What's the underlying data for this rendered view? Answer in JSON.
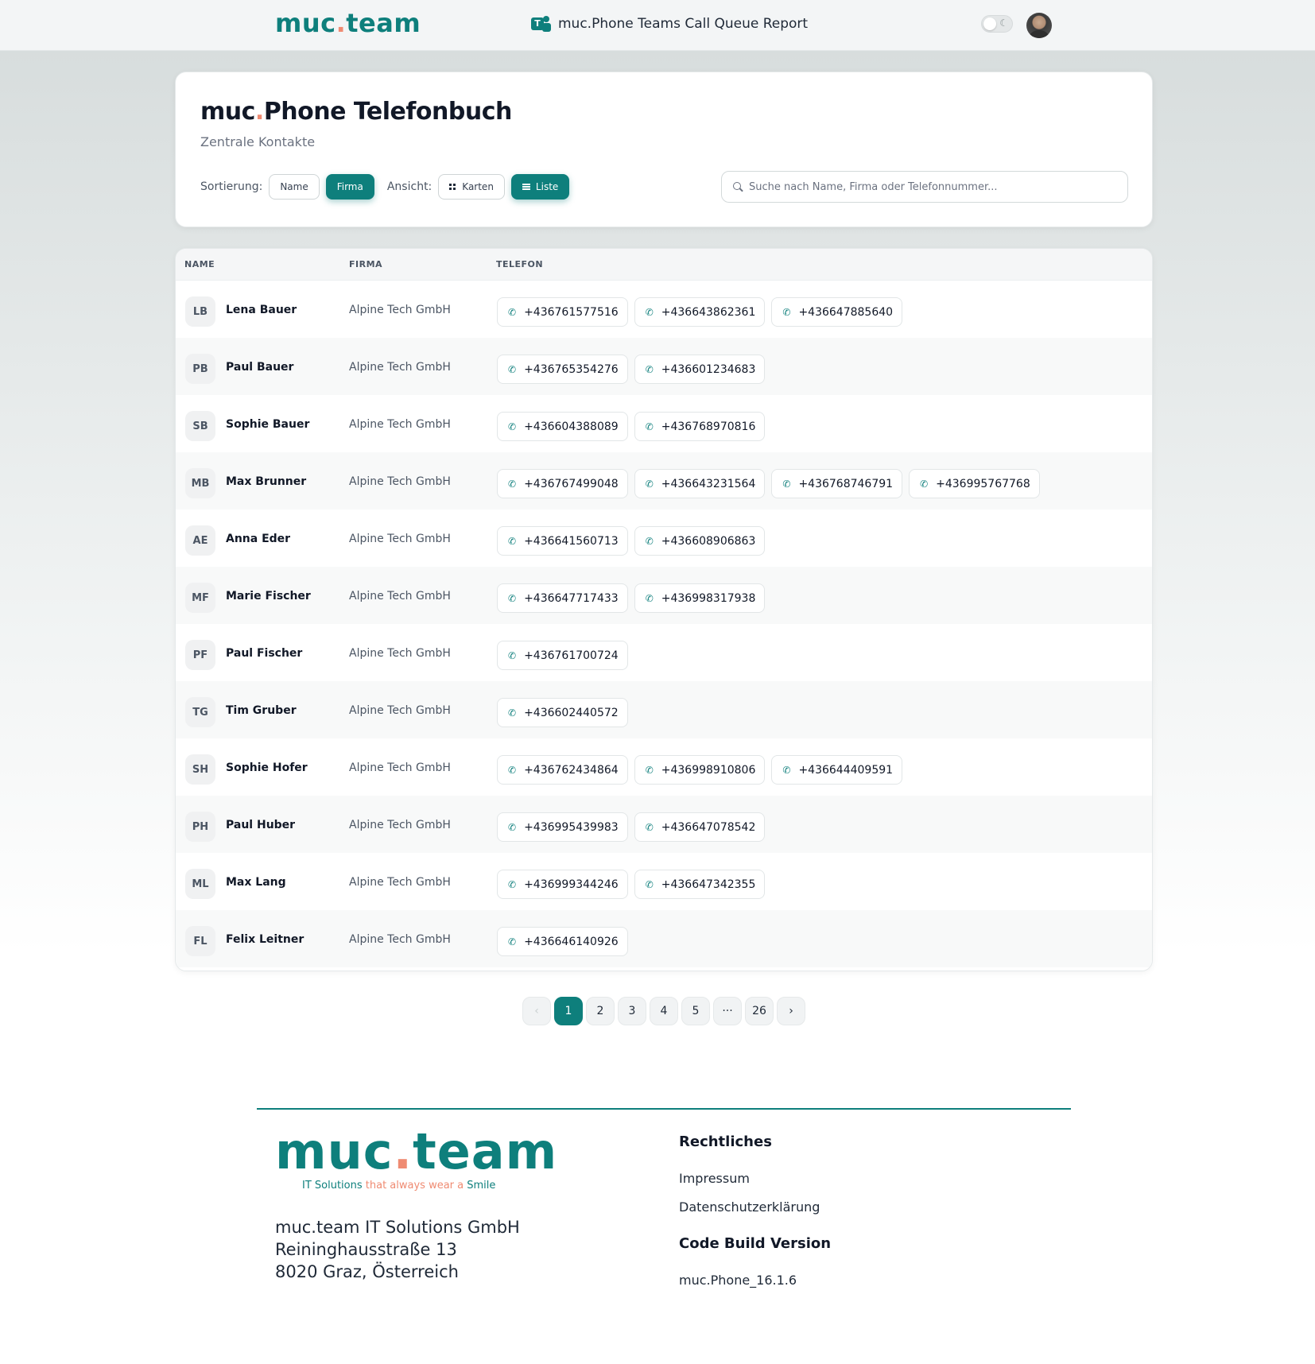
{
  "topbar": {
    "logo_left": "muc",
    "logo_dot": ".",
    "logo_right": "team",
    "report_title": "muc.Phone Teams Call Queue Report",
    "teams_icon": "teams-icon",
    "theme_icon": "moon-icon"
  },
  "header": {
    "title_left": "muc",
    "title_dot": ".",
    "title_right": "Phone Telefonbuch",
    "subtitle": "Zentrale Kontakte",
    "sort_label": "Sortierung:",
    "sort_name": "Name",
    "sort_company": "Firma",
    "view_label": "Ansicht:",
    "view_cards": "Karten",
    "view_list": "Liste",
    "search_placeholder": "Suche nach Name, Firma oder Telefonnummer..."
  },
  "table": {
    "headers": {
      "name": "NAME",
      "company": "FIRMA",
      "phone": "TELEFON"
    },
    "rows": [
      {
        "initials": "LB",
        "name": "Lena Bauer",
        "company": "Alpine Tech GmbH",
        "phones": [
          "+436761577516",
          "+436643862361",
          "+436647885640"
        ]
      },
      {
        "initials": "PB",
        "name": "Paul Bauer",
        "company": "Alpine Tech GmbH",
        "phones": [
          "+436765354276",
          "+436601234683"
        ]
      },
      {
        "initials": "SB",
        "name": "Sophie Bauer",
        "company": "Alpine Tech GmbH",
        "phones": [
          "+436604388089",
          "+436768970816"
        ]
      },
      {
        "initials": "MB",
        "name": "Max Brunner",
        "company": "Alpine Tech GmbH",
        "phones": [
          "+436767499048",
          "+436643231564",
          "+436768746791",
          "+436995767768"
        ]
      },
      {
        "initials": "AE",
        "name": "Anna Eder",
        "company": "Alpine Tech GmbH",
        "phones": [
          "+436641560713",
          "+436608906863"
        ]
      },
      {
        "initials": "MF",
        "name": "Marie Fischer",
        "company": "Alpine Tech GmbH",
        "phones": [
          "+436647717433",
          "+436998317938"
        ]
      },
      {
        "initials": "PF",
        "name": "Paul Fischer",
        "company": "Alpine Tech GmbH",
        "phones": [
          "+436761700724"
        ]
      },
      {
        "initials": "TG",
        "name": "Tim Gruber",
        "company": "Alpine Tech GmbH",
        "phones": [
          "+436602440572"
        ]
      },
      {
        "initials": "SH",
        "name": "Sophie Hofer",
        "company": "Alpine Tech GmbH",
        "phones": [
          "+436762434864",
          "+436998910806",
          "+436644409591"
        ]
      },
      {
        "initials": "PH",
        "name": "Paul Huber",
        "company": "Alpine Tech GmbH",
        "phones": [
          "+436995439983",
          "+436647078542"
        ]
      },
      {
        "initials": "ML",
        "name": "Max Lang",
        "company": "Alpine Tech GmbH",
        "phones": [
          "+436999344246",
          "+436647342355"
        ]
      },
      {
        "initials": "FL",
        "name": "Felix Leitner",
        "company": "Alpine Tech GmbH",
        "phones": [
          "+436646140926"
        ]
      }
    ]
  },
  "pagination": {
    "prev": "‹",
    "pages": [
      "1",
      "2",
      "3",
      "4",
      "5",
      "···",
      "26"
    ],
    "current": "1",
    "next": "›"
  },
  "footer": {
    "logo_left": "muc",
    "logo_dot": ".",
    "logo_right": "team",
    "tagline_a": "IT Solutions",
    "tagline_b": " that always wear a ",
    "tagline_c": "Smile",
    "address": [
      "muc.team IT Solutions GmbH",
      "Reininghausstraße 13",
      "8020 Graz, Österreich"
    ],
    "legal_heading": "Rechtliches",
    "imprint": "Impressum",
    "privacy": "Datenschutzerklärung",
    "build_heading": "Code Build Version",
    "build_version": "muc.Phone_16.1.6"
  },
  "colors": {
    "accent": "#0e7f7c",
    "dot": "#ef8b72"
  }
}
